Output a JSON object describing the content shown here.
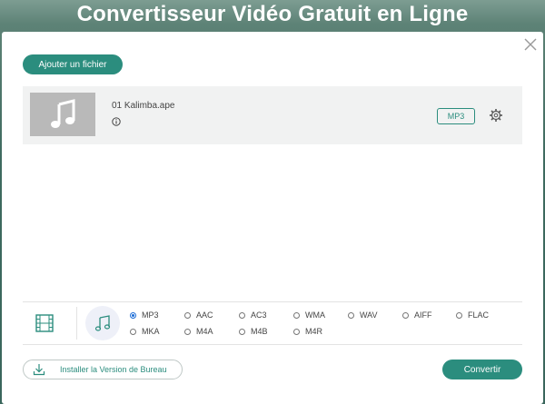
{
  "page": {
    "title": "Convertisseur Vidéo Gratuit en Ligne"
  },
  "toolbar": {
    "add_file_label": "Ajouter un fichier"
  },
  "file": {
    "name": "01 Kalimba.ape",
    "format": "MP3"
  },
  "formats": {
    "row1": [
      "MP3",
      "AAC",
      "AC3",
      "WMA",
      "WAV",
      "AIFF",
      "FLAC"
    ],
    "row2": [
      "MKA",
      "M4A",
      "M4B",
      "M4R"
    ],
    "selected": "MP3"
  },
  "footer": {
    "install_label": "Installer la Version de Bureau",
    "convert_label": "Convertir"
  },
  "colors": {
    "accent": "#2b8d7e",
    "radio_selected": "#1a6bd6"
  },
  "icons": [
    "close-icon",
    "music-note-icon",
    "info-icon",
    "gear-icon",
    "film-icon",
    "download-icon"
  ]
}
